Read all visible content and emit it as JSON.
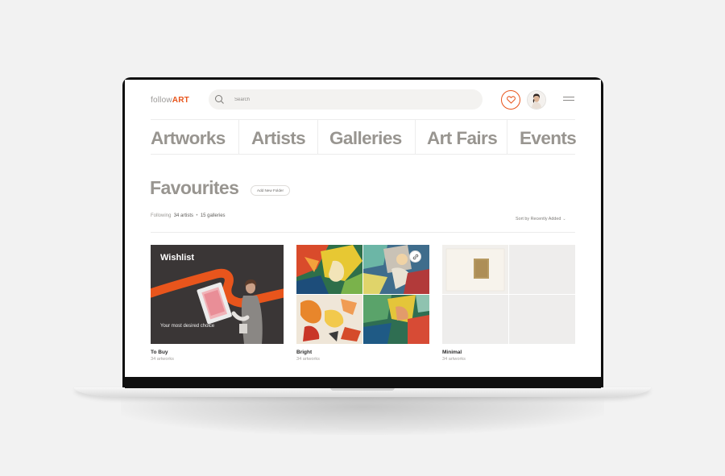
{
  "header": {
    "logo_part1": "follow",
    "logo_part2": "ART",
    "search_placeholder": "Search"
  },
  "nav": {
    "items": [
      "Artworks",
      "Artists",
      "Galleries",
      "Art Fairs",
      "Events"
    ]
  },
  "favourites": {
    "title": "Favourites",
    "add_folder_label": "Add New Folder",
    "following_label": "Following",
    "artists_count": "34 artists",
    "separator": "•",
    "galleries_count": "15 galleries",
    "sort_label": "Sort by Recently Added"
  },
  "folders": [
    {
      "name": "To Buy",
      "count": "34 artworks",
      "cover_title": "Wishlist",
      "cover_subtitle": "Your most desired choice"
    },
    {
      "name": "Bright",
      "count": "34 artworks"
    },
    {
      "name": "Minimal",
      "count": "34 artworks"
    }
  ],
  "colors": {
    "accent": "#e8551c",
    "nav_text": "#989590",
    "wishlist_bg": "#3a3636"
  },
  "icons": {
    "search": "search-icon",
    "favourites": "heart-icon",
    "menu": "hamburger-menu-icon",
    "link": "link-icon",
    "sort": "chevron-down-icon"
  }
}
